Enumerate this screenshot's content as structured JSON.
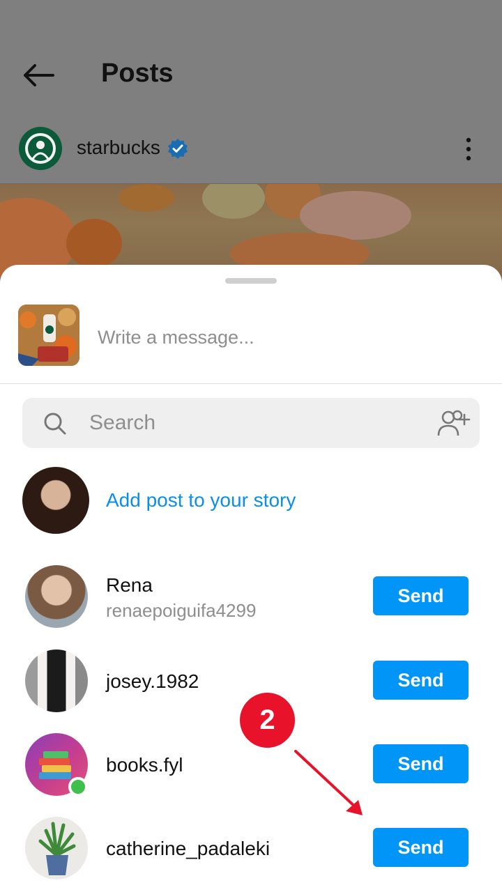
{
  "header": {
    "title": "Posts"
  },
  "post": {
    "account": "starbucks"
  },
  "share_sheet": {
    "message_placeholder": "Write a message...",
    "search_placeholder": "Search",
    "add_to_story_label": "Add post to your story",
    "contacts": [
      {
        "name": "Rena",
        "username": "renaepoiguifa4299",
        "button": "Send"
      },
      {
        "name": "josey.1982",
        "username": "",
        "button": "Send"
      },
      {
        "name": "books.fyl",
        "username": "",
        "button": "Send",
        "online": true
      },
      {
        "name": "catherine_padaleki",
        "username": "",
        "button": "Send"
      }
    ]
  },
  "annotation": {
    "step_number": "2"
  },
  "colors": {
    "accent_blue": "#0095f6",
    "link_blue": "#0a8ee8",
    "annotation_red": "#e8132a",
    "online_green": "#3ec04a"
  }
}
